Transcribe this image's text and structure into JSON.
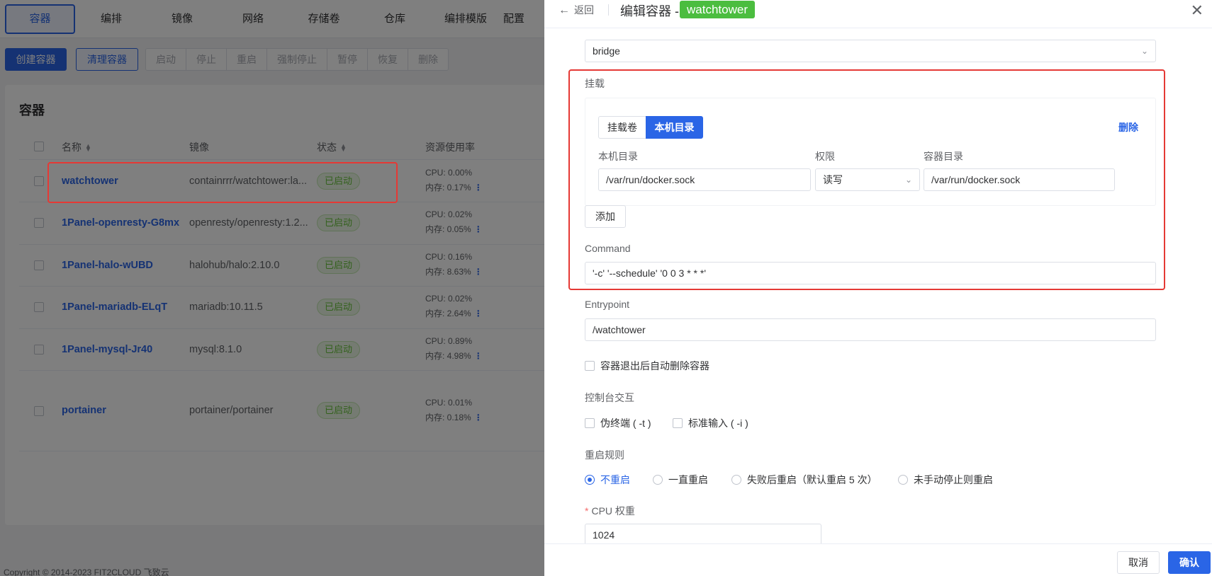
{
  "nav": {
    "tabs": [
      "容器",
      "编排",
      "镜像",
      "网络",
      "存储卷",
      "仓库",
      "编排模版",
      "配置"
    ]
  },
  "toolbar": {
    "create": "创建容器",
    "clean": "清理容器",
    "group": [
      "启动",
      "停止",
      "重启",
      "强制停止",
      "暂停",
      "恢复",
      "删除"
    ]
  },
  "list": {
    "title": "容器",
    "headers": {
      "name": "名称",
      "image": "镜像",
      "status": "状态",
      "resources": "资源使用率"
    },
    "rows": [
      {
        "name": "watchtower",
        "image": "containrrr/watchtower:la...",
        "status": "已启动",
        "cpu": "CPU: 0.00%",
        "mem": "内存: 0.17%"
      },
      {
        "name": "1Panel-openresty-G8mx",
        "image": "openresty/openresty:1.2...",
        "status": "已启动",
        "cpu": "CPU: 0.02%",
        "mem": "内存: 0.05%"
      },
      {
        "name": "1Panel-halo-wUBD",
        "image": "halohub/halo:2.10.0",
        "status": "已启动",
        "cpu": "CPU: 0.16%",
        "mem": "内存: 8.63%"
      },
      {
        "name": "1Panel-mariadb-ELqT",
        "image": "mariadb:10.11.5",
        "status": "已启动",
        "cpu": "CPU: 0.02%",
        "mem": "内存: 2.64%"
      },
      {
        "name": "1Panel-mysql-Jr40",
        "image": "mysql:8.1.0",
        "status": "已启动",
        "cpu": "CPU: 0.89%",
        "mem": "内存: 4.98%"
      },
      {
        "name": "portainer",
        "image": "portainer/portainer",
        "status": "已启动",
        "cpu": "CPU: 0.01%",
        "mem": "内存: 0.18%"
      }
    ],
    "more": "⋮"
  },
  "footer": "Copyright © 2014-2023 FIT2CLOUD 飞致云",
  "drawer": {
    "back": "返回",
    "title": "编辑容器 -",
    "tag": "watchtower",
    "network_value": "bridge",
    "mount": {
      "label": "挂载",
      "tab_volume": "挂载卷",
      "tab_host": "本机目录",
      "delete": "删除",
      "host_dir_label": "本机目录",
      "perm_label": "权限",
      "container_dir_label": "容器目录",
      "host_dir_value": "/var/run/docker.sock",
      "perm_value": "读写",
      "container_dir_value": "/var/run/docker.sock",
      "add": "添加"
    },
    "command_label": "Command",
    "command_value": "'-c' '--schedule' '0 0 3 * * *'",
    "entrypoint_label": "Entrypoint",
    "entrypoint_value": "/watchtower",
    "auto_remove": "容器退出后自动删除容器",
    "console_label": "控制台交互",
    "tty": "伪终端 ( -t )",
    "stdin": "标准输入 ( -i )",
    "restart_label": "重启规则",
    "restart_options": [
      "不重启",
      "一直重启",
      "失败后重启（默认重启 5 次）",
      "未手动停止则重启"
    ],
    "cpu_label": "CPU 权重",
    "cpu_value": "1024",
    "cancel": "取消",
    "confirm": "确认"
  }
}
